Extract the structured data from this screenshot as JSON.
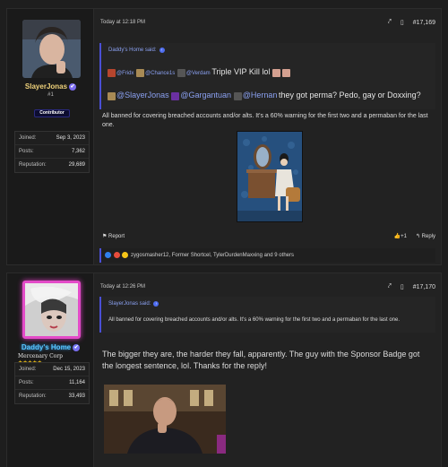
{
  "posts": [
    {
      "user": {
        "name": "SlayerJonas",
        "rank": "#1",
        "badge": "Contributor",
        "stats": [
          {
            "k": "Joined:",
            "v": "Sep 3, 2023"
          },
          {
            "k": "Posts:",
            "v": "7,362"
          },
          {
            "k": "Reputation:",
            "v": "29,689"
          }
        ]
      },
      "timestamp": "Today at 12:18 PM",
      "post_number": "#17,169",
      "quote": {
        "author": "Daddy's Home said:",
        "line1_mentions": [
          "@Fridx",
          "@Chance1s",
          "@Verdam"
        ],
        "line1_text": "Triple VIP Kill lol",
        "line2_mentions": [
          "@SlayerJonas",
          "@Gargantuan",
          "@Hernan"
        ],
        "line2_text": "they got perma? Pedo, gay or Doxxing?"
      },
      "body": "All banned for covering breached accounts and/or alts. It's a 60% warning for the first two and a permaban for the last one.",
      "actions": {
        "report": "Report",
        "like": "+1",
        "reply": "Reply"
      },
      "reactions": "zygosmasher12, Former Shortcel, TylerDurdenMaxxing and 9 others"
    },
    {
      "user": {
        "name": "Daddy's Home",
        "title": "Mercenary Corp",
        "stars": "★★★★★",
        "stats": [
          {
            "k": "Joined:",
            "v": "Dec 15, 2023"
          },
          {
            "k": "Posts:",
            "v": "11,164"
          },
          {
            "k": "Reputation:",
            "v": "33,493"
          }
        ]
      },
      "timestamp": "Today at 12:26 PM",
      "post_number": "#17,170",
      "quote": {
        "author": "SlayerJonas said:",
        "text": "All banned for covering breached accounts and/or alts. It's a 60% warning for the first two and a permaban for the last one."
      },
      "body": "The bigger they are, the harder they fall, apparently. The guy with the Sponsor Badge got the longest sentence, lol. Thanks for the reply!"
    }
  ],
  "icons": {
    "share": "share-icon",
    "bookmark": "bookmark-icon",
    "verified": "verified-icon"
  }
}
